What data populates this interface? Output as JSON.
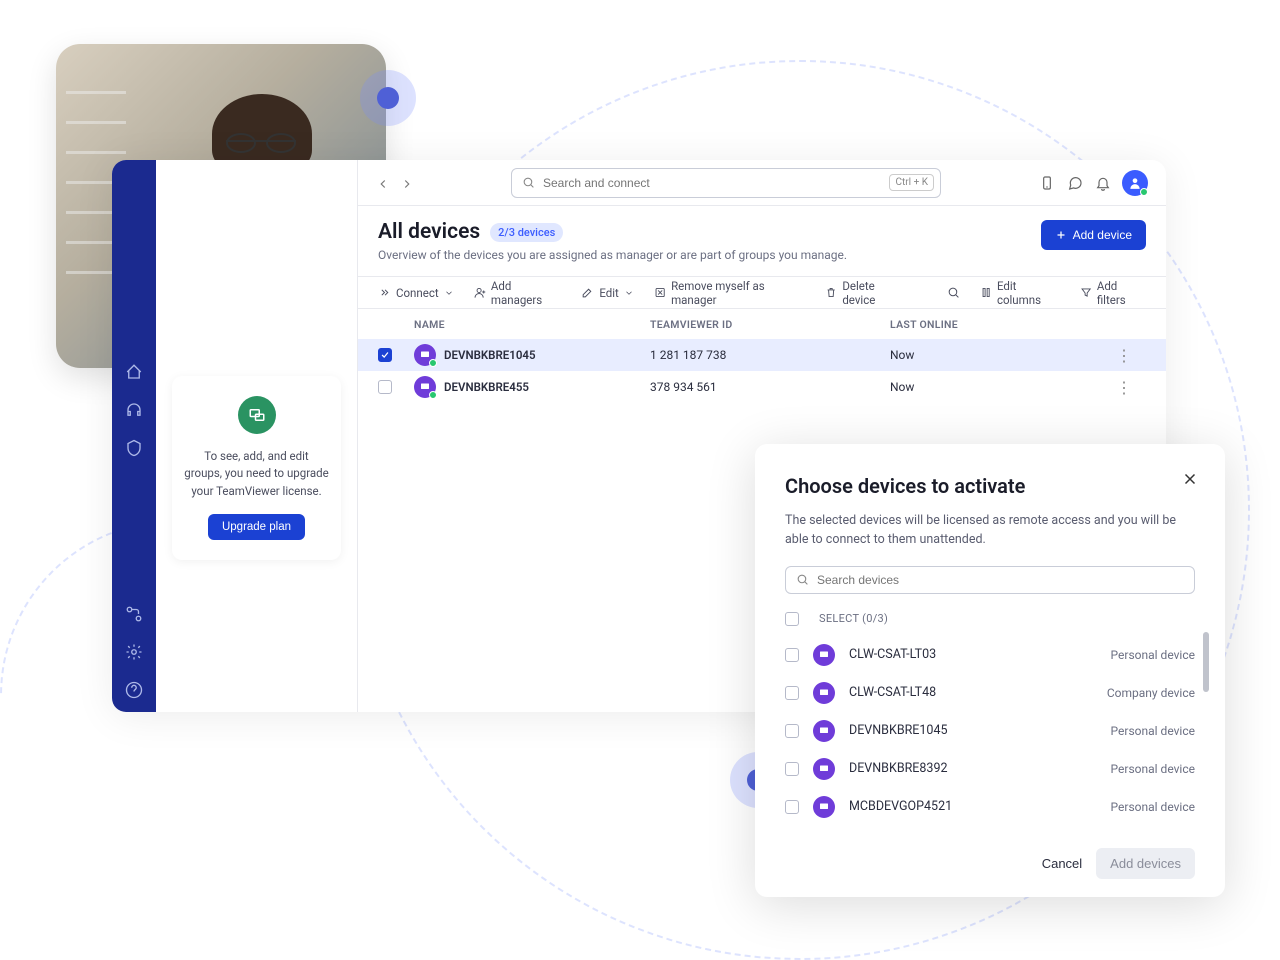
{
  "hero": {
    "alt": "Man with glasses typing on laptop"
  },
  "header": {
    "search_placeholder": "Search and connect",
    "search_shortcut": "Ctrl + K"
  },
  "page": {
    "title": "All devices",
    "badge": "2/3 devices",
    "subtitle": "Overview of the devices you are assigned as manager or are part of groups you manage.",
    "add_device_label": "Add device"
  },
  "toolbar": {
    "connect": "Connect",
    "add_managers": "Add managers",
    "edit": "Edit",
    "remove_self": "Remove myself as manager",
    "delete": "Delete device",
    "edit_columns": "Edit columns",
    "add_filters": "Add filters"
  },
  "columns": {
    "name": "NAME",
    "tvid": "TEAMVIEWER ID",
    "last": "LAST ONLINE"
  },
  "devices": [
    {
      "name": "DEVNBKBRE1045",
      "tvid": "1 281 187 738",
      "last": "Now",
      "selected": true
    },
    {
      "name": "DEVNBKBRE455",
      "tvid": "378 934 561",
      "last": "Now",
      "selected": false
    }
  ],
  "upgrade": {
    "text": "To see, add, and edit groups, you need to upgrade your TeamViewer license.",
    "button": "Upgrade plan"
  },
  "modal": {
    "title": "Choose devices to activate",
    "description": "The selected devices will be licensed as remote access and you will be able to connect to them unattended.",
    "search_placeholder": "Search devices",
    "select_header": "SELECT (0/3)",
    "devices": [
      {
        "name": "CLW-CSAT-LT03",
        "type": "Personal device"
      },
      {
        "name": "CLW-CSAT-LT48",
        "type": "Company device"
      },
      {
        "name": "DEVNBKBRE1045",
        "type": "Personal device"
      },
      {
        "name": "DEVNBKBRE8392",
        "type": "Personal device"
      },
      {
        "name": "MCBDEVGOP4521",
        "type": "Personal device"
      }
    ],
    "cancel": "Cancel",
    "add": "Add devices"
  }
}
